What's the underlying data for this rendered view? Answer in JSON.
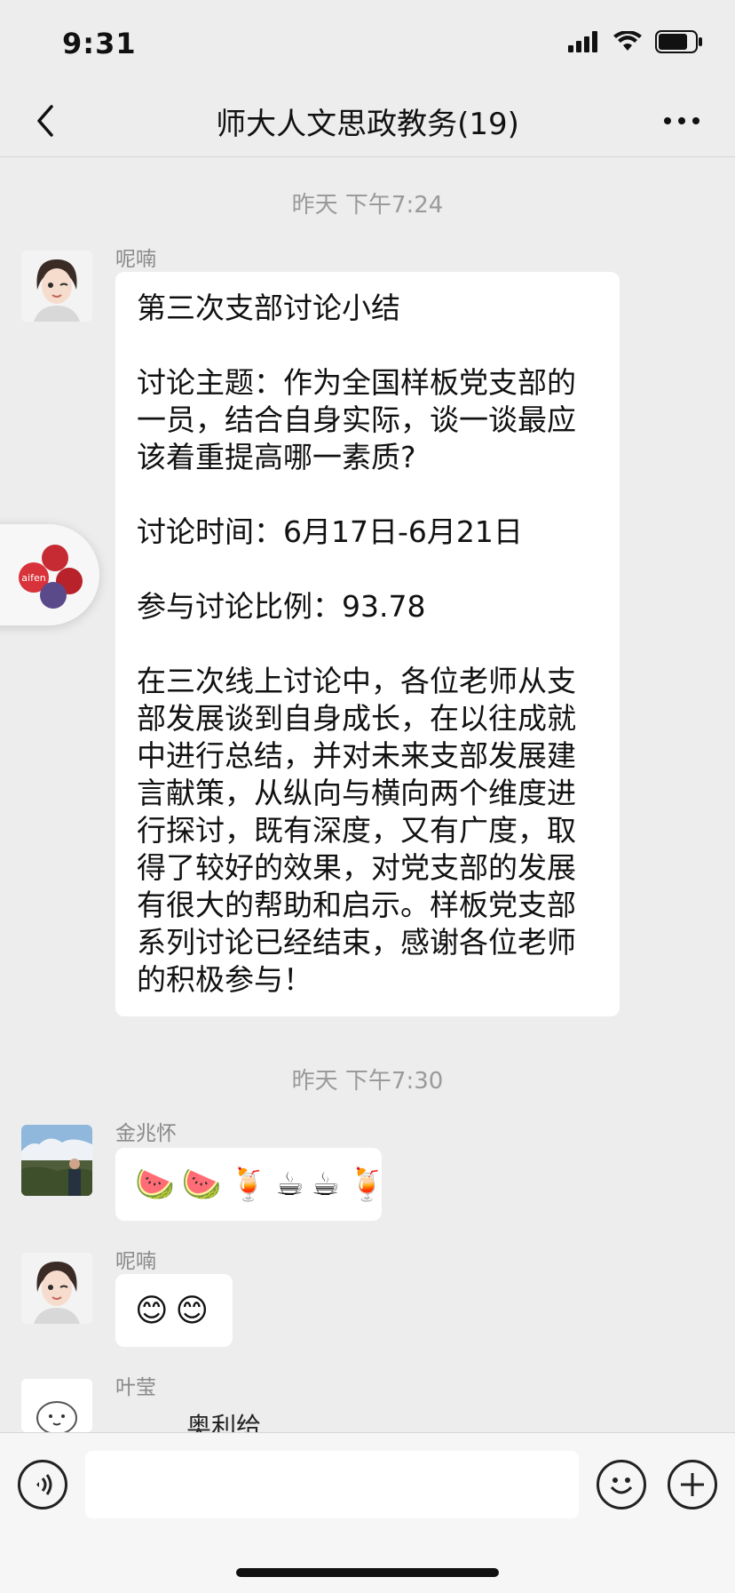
{
  "status": {
    "time": "9:31"
  },
  "nav": {
    "title": "师大人文思政教务(19)"
  },
  "messages": [
    {
      "time": "昨天 下午7:24",
      "sender": "呢喃",
      "text": "第三次支部讨论小结\n\n讨论主题：作为全国样板党支部的一员，结合自身实际，谈一谈最应该着重提高哪一素质?\n\n讨论时间：6月17日-6月21日\n\n参与讨论比例：93.78\n\n在三次线上讨论中，各位老师从支部发展谈到自身成长，在以往成就中进行总结，并对未来支部发展建言献策，从纵向与横向两个维度进行探讨，既有深度，又有广度，取得了较好的效果，对党支部的发展有很大的帮助和启示。样板党支部系列讨论已经结束，感谢各位老师的积极参与！"
    },
    {
      "time": "昨天 下午7:30",
      "sender": "金兆怀",
      "emojis": [
        "🍉",
        "🍉",
        "🍹",
        "☕",
        "☕",
        "🍹"
      ]
    },
    {
      "sender": "呢喃",
      "emojis": [
        "😊",
        "😊"
      ]
    },
    {
      "sender": "叶莹",
      "partial_text": "奥利给"
    }
  ],
  "widget": {
    "label": "aifen"
  },
  "icons": {
    "back": "chevron-left-icon",
    "more": "more-dots-icon",
    "voice": "voice-icon",
    "emoji": "emoji-icon",
    "add": "plus-icon"
  }
}
